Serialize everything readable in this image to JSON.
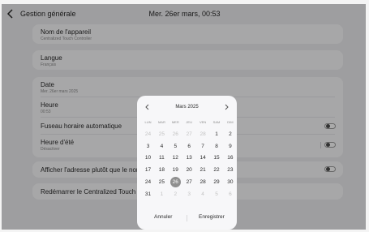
{
  "header": {
    "back_icon": "chevron-left-icon",
    "title": "Gestion générale",
    "datetime": "Mer. 26er mars, 00:53"
  },
  "settings": {
    "device_name": {
      "label": "Nom de l'appareil",
      "value": "Centralized Touch Controller"
    },
    "language": {
      "label": "Langue",
      "value": "Français"
    },
    "date": {
      "label": "Date",
      "value": "Mer. 26er mars 2025"
    },
    "time": {
      "label": "Heure",
      "value": "00:53"
    },
    "auto_timezone": {
      "label": "Fuseau horaire automatique",
      "state": "off"
    },
    "dst": {
      "label": "Heure d'été",
      "value": "Désactiver",
      "state": "off"
    },
    "show_address": {
      "label": "Afficher l'adresse plutôt que le nom de l",
      "state": "off"
    },
    "restart": {
      "label": "Redémarrer le Centralized Touch Contro"
    }
  },
  "picker": {
    "month_title": "Mars 2025",
    "prev_icon": "chevron-left-icon",
    "next_icon": "chevron-right-icon",
    "weekdays": [
      "LUN",
      "MAR",
      "MER",
      "JEU",
      "VEN",
      "SAM",
      "DIM"
    ],
    "weeks": [
      [
        "24",
        "25",
        "26",
        "27",
        "28",
        "1",
        "2"
      ],
      [
        "3",
        "4",
        "5",
        "6",
        "7",
        "8",
        "9"
      ],
      [
        "10",
        "11",
        "12",
        "13",
        "14",
        "15",
        "16"
      ],
      [
        "17",
        "18",
        "19",
        "20",
        "21",
        "22",
        "23"
      ],
      [
        "24",
        "25",
        "26",
        "27",
        "28",
        "29",
        "30"
      ],
      [
        "31",
        "1",
        "2",
        "3",
        "4",
        "5",
        "6"
      ]
    ],
    "muted_days": [
      [
        0,
        0
      ],
      [
        0,
        1
      ],
      [
        0,
        2
      ],
      [
        0,
        3
      ],
      [
        0,
        4
      ],
      [
        5,
        1
      ],
      [
        5,
        2
      ],
      [
        5,
        3
      ],
      [
        5,
        4
      ],
      [
        5,
        5
      ],
      [
        5,
        6
      ]
    ],
    "selected_day": [
      4,
      2
    ],
    "cancel_label": "Annuler",
    "save_label": "Enregistrer"
  }
}
